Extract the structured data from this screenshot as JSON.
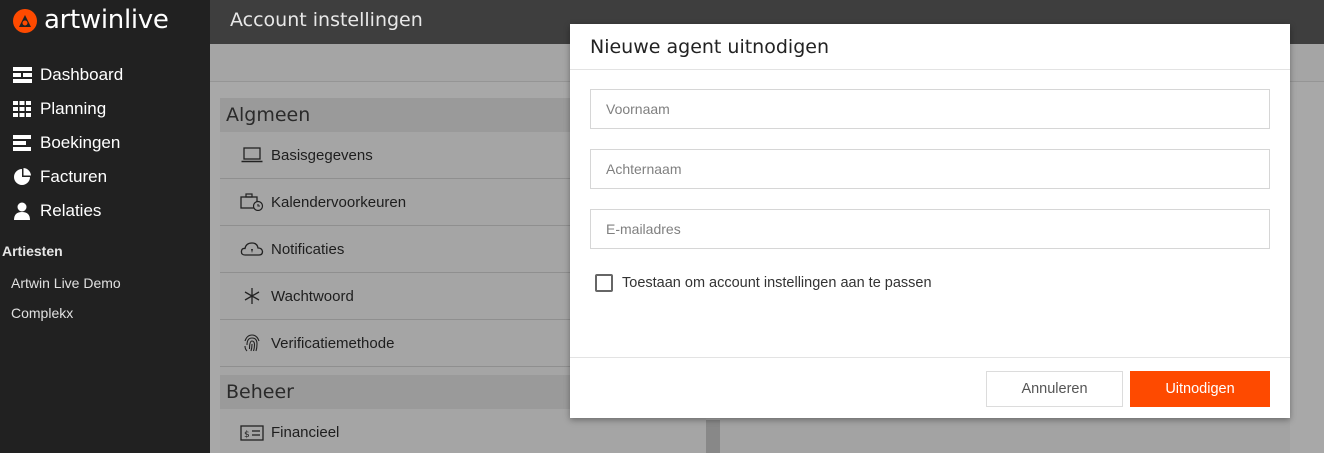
{
  "app": {
    "logo_text": "artwinlive",
    "brand_color": "#fe4a00"
  },
  "sidebar": {
    "items": [
      {
        "label": "Dashboard",
        "icon": "dashboard-icon"
      },
      {
        "label": "Planning",
        "icon": "grid-icon"
      },
      {
        "label": "Boekingen",
        "icon": "list-icon"
      },
      {
        "label": "Facturen",
        "icon": "pie-chart-icon"
      },
      {
        "label": "Relaties",
        "icon": "user-icon"
      }
    ],
    "section_title": "Artiesten",
    "artists": [
      "Artwin Live Demo",
      "Complekx"
    ]
  },
  "header": {
    "title": "Account instellingen"
  },
  "settings": {
    "groups": [
      {
        "title": "Algmeen",
        "items": [
          {
            "label": "Basisgegevens",
            "icon": "laptop-icon"
          },
          {
            "label": "Kalendervoorkeuren",
            "icon": "briefcase-clock-icon"
          },
          {
            "label": "Notificaties",
            "icon": "notification-cloud-icon"
          },
          {
            "label": "Wachtwoord",
            "icon": "asterisk-icon"
          },
          {
            "label": "Verificatiemethode",
            "icon": "fingerprint-icon"
          }
        ]
      },
      {
        "title": "Beheer",
        "items": [
          {
            "label": "Financieel",
            "icon": "money-card-icon"
          }
        ]
      }
    ]
  },
  "modal": {
    "title": "Nieuwe agent uitnodigen",
    "fields": {
      "firstname_placeholder": "Voornaam",
      "lastname_placeholder": "Achternaam",
      "email_placeholder": "E-mailadres"
    },
    "checkbox_label": "Toestaan om account instellingen aan te passen",
    "checkbox_checked": false,
    "cancel_label": "Annuleren",
    "submit_label": "Uitnodigen"
  }
}
